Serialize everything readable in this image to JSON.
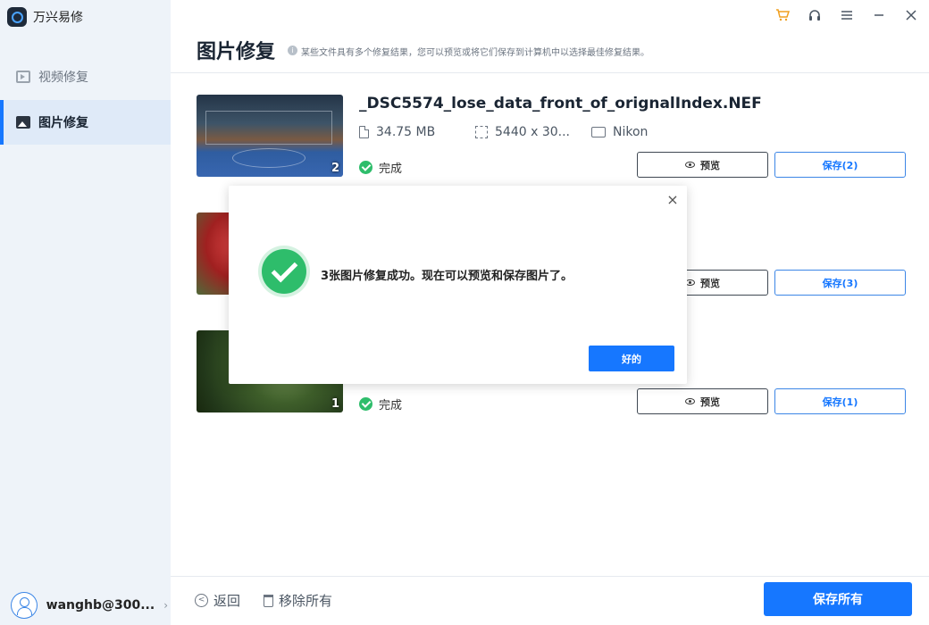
{
  "app": {
    "title": "万兴易修"
  },
  "sidebar": {
    "items": [
      {
        "label": "视频修复",
        "icon": "video-icon",
        "active": false
      },
      {
        "label": "图片修复",
        "icon": "photo-icon",
        "active": true
      }
    ],
    "user": {
      "name": "wanghb@300...",
      "chevron": "›"
    }
  },
  "topbar": {
    "icons": [
      "cart-icon",
      "headset-icon",
      "menu-icon",
      "minimize-icon",
      "close-icon"
    ]
  },
  "page": {
    "title": "图片修复",
    "info_glyph": "i",
    "subtitle": "某些文件具有多个修复结果，您可以预览或将它们保存到计算机中以选择最佳修复结果。"
  },
  "results": [
    {
      "file_name": "_DSC5574_lose_data_front_of_orignalIndex.NEF",
      "size": "34.75  MB",
      "resolution": "5440 x 30...",
      "camera": "Nikon",
      "status": "完成",
      "count": "2",
      "preview_label": "预览",
      "save_label": "保存(2)"
    },
    {
      "preview_label": "预览",
      "save_label": "保存(3)"
    },
    {
      "status": "完成",
      "count": "1",
      "preview_label": "预览",
      "save_label": "保存(1)"
    }
  ],
  "bottom": {
    "back_label": "返回",
    "back_glyph": "<",
    "remove_all_label": "移除所有",
    "save_all_label": "保存所有"
  },
  "dialog": {
    "message": "3张图片修复成功。现在可以预览和保存图片了。",
    "ok_label": "好的",
    "close_glyph": "×"
  },
  "colors": {
    "accent": "#1677ff",
    "success": "#2ebd6b",
    "sidebar_bg": "#eef3f9"
  }
}
